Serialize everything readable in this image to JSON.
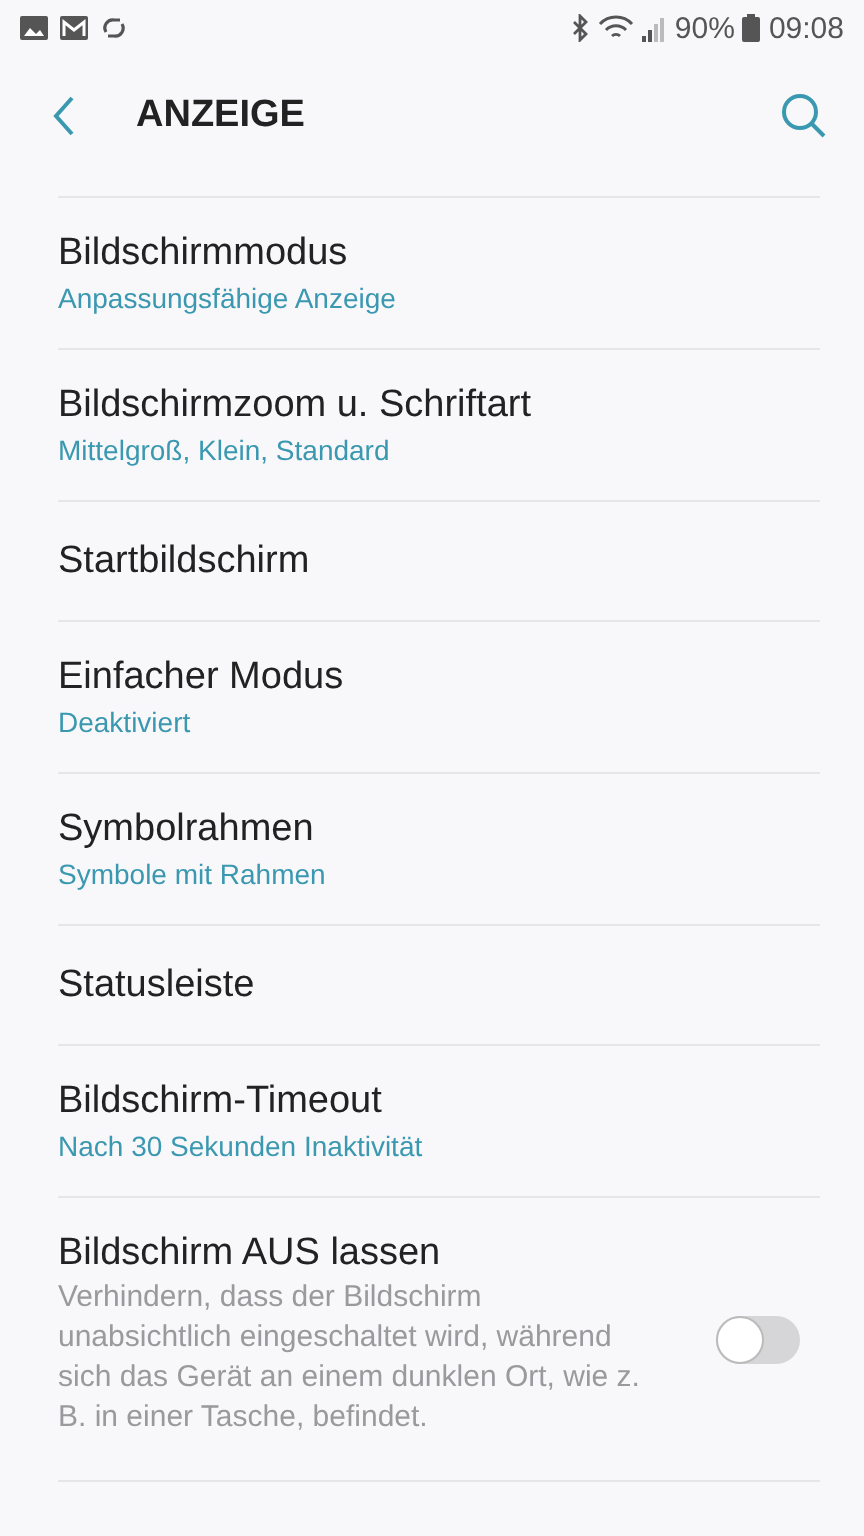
{
  "status_bar": {
    "battery": "90%",
    "time": "09:08"
  },
  "header": {
    "title": "ANZEIGE"
  },
  "items": [
    {
      "kind": "link",
      "title": "Bildschirmmodus",
      "subtitle": "Anpassungsfähige Anzeige"
    },
    {
      "kind": "link",
      "title": "Bildschirmzoom u. Schriftart",
      "subtitle": "Mittelgroß, Klein, Standard"
    },
    {
      "kind": "link",
      "title": "Startbildschirm"
    },
    {
      "kind": "link",
      "title": "Einfacher Modus",
      "subtitle": "Deaktiviert"
    },
    {
      "kind": "link",
      "title": "Symbolrahmen",
      "subtitle": "Symbole mit Rahmen"
    },
    {
      "kind": "link",
      "title": "Statusleiste"
    },
    {
      "kind": "link",
      "title": "Bildschirm-Timeout",
      "subtitle": "Nach 30 Sekunden Inaktivität"
    },
    {
      "kind": "switch",
      "title": "Bildschirm AUS lassen",
      "description": "Verhindern, dass der Bildschirm unabsichtlich eingeschaltet wird, während sich das Gerät an einem dunklen Ort, wie z. B. in einer Tasche, befindet.",
      "on": false
    }
  ]
}
